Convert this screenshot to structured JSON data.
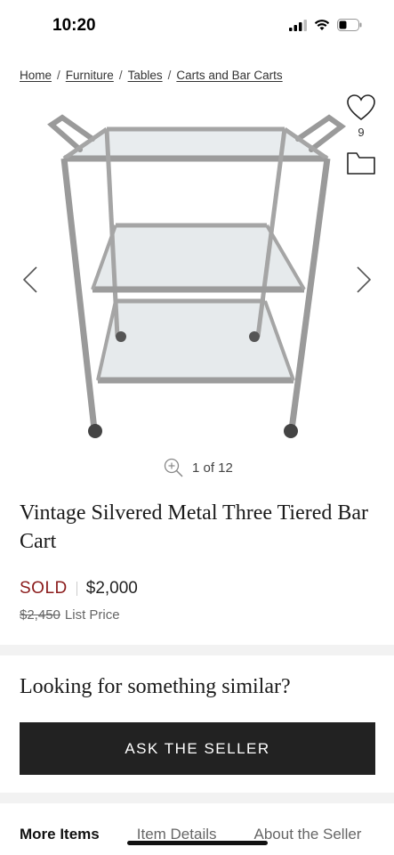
{
  "status_bar": {
    "time": "10:20"
  },
  "breadcrumb": [
    "Home",
    "Furniture",
    "Tables",
    "Carts and Bar Carts"
  ],
  "favorites": {
    "count": "9",
    "icon": "heart-icon"
  },
  "gallery": {
    "position": "1 of 12"
  },
  "product": {
    "title": "Vintage Silvered Metal Three Tiered Bar Cart",
    "status": "SOLD",
    "price": "$2,000",
    "list_price": "$2,450",
    "list_price_label": "List Price"
  },
  "similar": {
    "heading": "Looking for something similar?",
    "button_label": "ASK THE SELLER"
  },
  "tabs": [
    {
      "label": "More Items"
    },
    {
      "label": "Item Details"
    },
    {
      "label": "About the Seller"
    }
  ],
  "colors": {
    "sold": "#8b1b1b",
    "button_bg": "#222222"
  }
}
